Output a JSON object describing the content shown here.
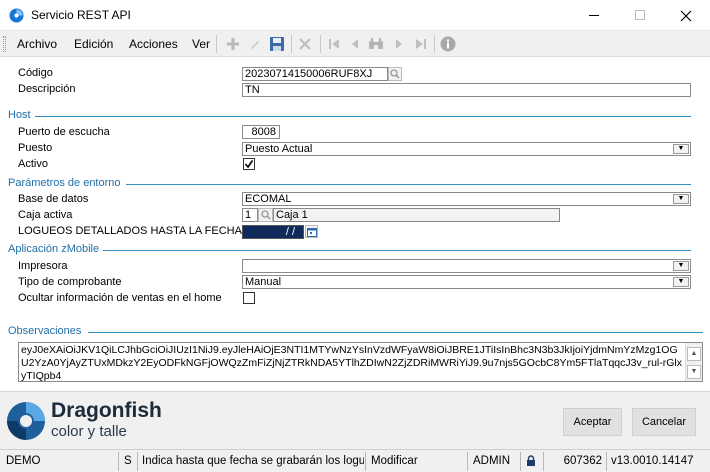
{
  "window": {
    "title": "Servicio REST API"
  },
  "menu": {
    "items": [
      "Archivo",
      "Edición",
      "Acciones",
      "Ver"
    ]
  },
  "toolbar": {
    "icons": [
      "plus-icon",
      "edit-icon",
      "save-icon",
      "delete-icon",
      "first-icon",
      "prev-icon",
      "search-icon",
      "next-icon",
      "last-icon",
      "info-icon"
    ]
  },
  "form": {
    "codigo": {
      "label": "Código",
      "value": "20230714150006RUF8XJ"
    },
    "descripcion": {
      "label": "Descripción",
      "value": "TN"
    }
  },
  "host": {
    "title": "Host",
    "puerto": {
      "label": "Puerto de escucha",
      "value": "8008"
    },
    "puesto": {
      "label": "Puesto",
      "value": "Puesto Actual"
    },
    "activo": {
      "label": "Activo",
      "checked": true
    }
  },
  "entorno": {
    "title": "Parámetros de entorno",
    "base": {
      "label": "Base de datos",
      "value": "ECOMAL"
    },
    "caja": {
      "label": "Caja activa",
      "number": "1",
      "name": "Caja 1"
    },
    "logueos": {
      "label": "LOGUEOS DETALLADOS HASTA LA FECHA",
      "value": "/ /"
    }
  },
  "zmobile": {
    "title": "Aplicación zMobile",
    "impresora": {
      "label": "Impresora",
      "value": ""
    },
    "comprobante": {
      "label": "Tipo de comprobante",
      "value": "Manual"
    },
    "ocultar": {
      "label": "Ocultar información de ventas en el home",
      "checked": false
    }
  },
  "observaciones": {
    "title": "Observaciones",
    "text": "eyJ0eXAiOiJKV1QiLCJhbGciOiJIUzI1NiJ9.eyJleHAiOjE3NTI1MTYwNzYsInVzdWFyaW8iOiJBRE1JTiIsInBhc3N3b3JkIjoiYjdmNmYzMzg1OGU2YzA0YjAyZTUxMDkzY2EyODFkNGFjOWQzZmFiZjNjZTRkNDA5YTlhZDIwN2ZjZDRiMWRiYiJ9.9u7njs5GOcbC8Ym5FTlaTqqcJ3v_rul-rGlxyTIQpb4"
  },
  "brand": {
    "name": "Dragonfish",
    "tagline": "color y talle"
  },
  "buttons": {
    "accept": "Aceptar",
    "cancel": "Cancelar"
  },
  "status": {
    "db": "DEMO",
    "mode": "S",
    "hint": "Indica hasta que fecha se grabarán los logueos",
    "state": "Modificar",
    "user": "ADMIN",
    "number": "607362",
    "version": "v13.0010.14147"
  },
  "colors": {
    "accent": "#1f6fa8",
    "date_fill": "#102a5c"
  }
}
